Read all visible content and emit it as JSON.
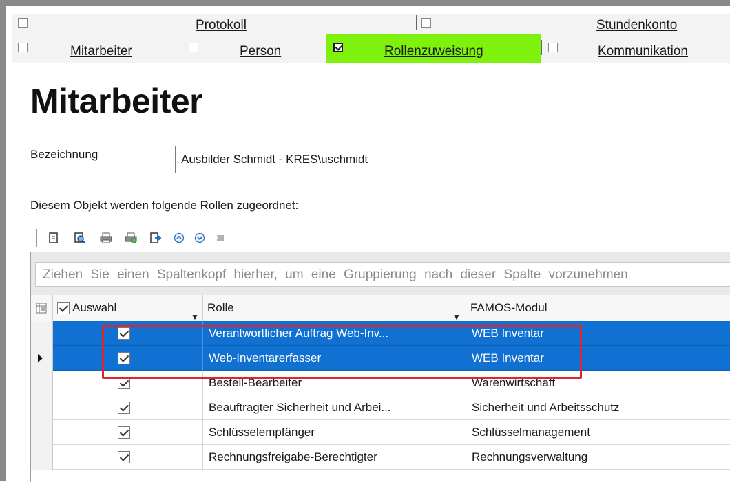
{
  "tabs": {
    "row1": [
      {
        "label": "Protokoll",
        "checked": false
      },
      {
        "label": "Stundenkonto",
        "checked": false
      }
    ],
    "row2": [
      {
        "label": "Mitarbeiter",
        "checked": false
      },
      {
        "label": "Person",
        "checked": false
      },
      {
        "label": "Rollenzuweisung",
        "checked": true,
        "active": true
      },
      {
        "label": "Kommunikation",
        "checked": false
      }
    ],
    "active_color": "#7ef20c"
  },
  "page": {
    "title": "Mitarbeiter",
    "bezeichnung_label": "Bezeichnung",
    "bezeichnung_value": "Ausbilder Schmidt - KRES\\uschmidt",
    "description": "Diesem Objekt werden folgende Rollen zugeordnet:"
  },
  "toolbar": {
    "icons": [
      "new-document-icon",
      "preview-icon",
      "print-icon",
      "print-setup-icon",
      "export-icon",
      "expand-all-icon",
      "collapse-all-icon",
      "group-icon"
    ]
  },
  "grid": {
    "group_hint": "Ziehen Sie einen Spaltenkopf hierher, um eine Gruppierung nach dieser Spalte vorzunehmen",
    "columns": [
      "Auswahl",
      "Rolle",
      "FAMOS-Modul"
    ],
    "rows": [
      {
        "auswahl": true,
        "rolle": "Verantwortlicher Auftrag Web-Inv...",
        "modul": "WEB Inventar",
        "selected": true,
        "current": false
      },
      {
        "auswahl": true,
        "rolle": "Web-Inventarerfasser",
        "modul": "WEB Inventar",
        "selected": true,
        "current": true
      },
      {
        "auswahl": true,
        "rolle": "Bestell-Bearbeiter",
        "modul": "Warenwirtschaft",
        "selected": false,
        "current": false
      },
      {
        "auswahl": true,
        "rolle": "Beauftragter Sicherheit und Arbei...",
        "modul": "Sicherheit und Arbeitsschutz",
        "selected": false,
        "current": false
      },
      {
        "auswahl": true,
        "rolle": "Schlüsselempfänger",
        "modul": "Schlüsselmanagement",
        "selected": false,
        "current": false
      },
      {
        "auswahl": true,
        "rolle": "Rechnungsfreigabe-Berechtigter",
        "modul": "Rechnungsverwaltung",
        "selected": false,
        "current": false
      }
    ],
    "selection_color": "#1171d2",
    "highlight_color": "#e0242f"
  }
}
